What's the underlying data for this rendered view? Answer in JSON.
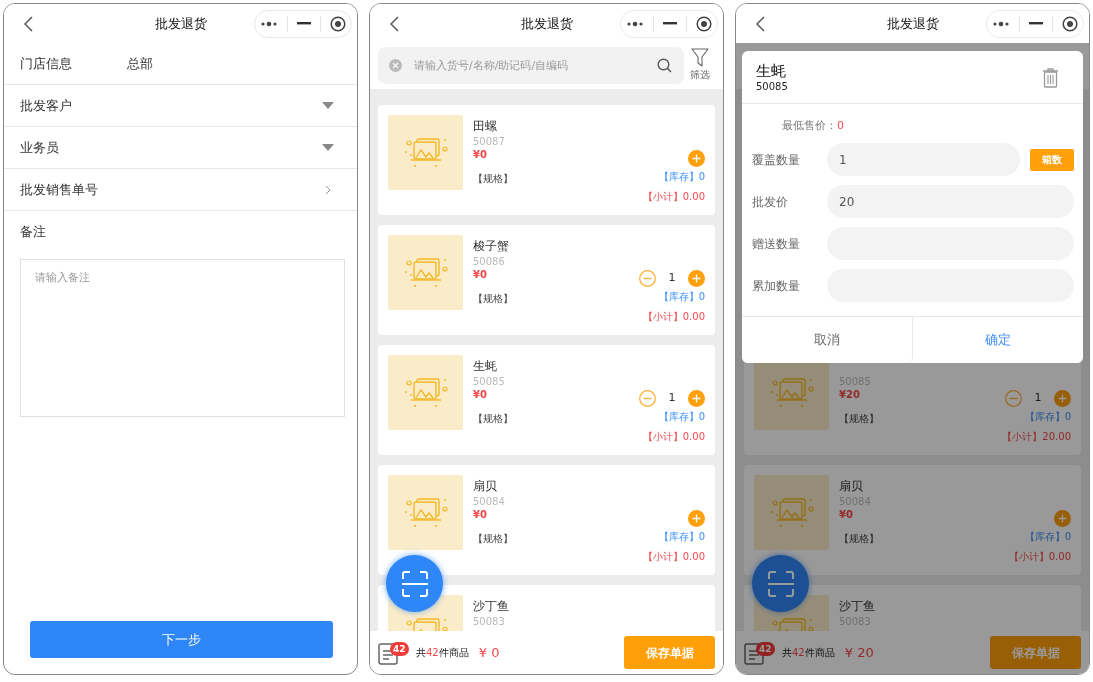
{
  "form_screen": {
    "title": "批发退货",
    "rows": [
      {
        "kind": "info",
        "label": "门店信息",
        "value": "总部"
      },
      {
        "kind": "dropdown",
        "label": "批发客户"
      },
      {
        "kind": "dropdown",
        "label": "业务员"
      },
      {
        "kind": "link",
        "label": "批发销售单号"
      },
      {
        "kind": "notes",
        "label": "备注",
        "placeholder": "请输入备注"
      }
    ],
    "next_button": "下一步"
  },
  "list_screen": {
    "title": "批发退货",
    "search": {
      "placeholder": "请输入货号/名称/助记码/自编码"
    },
    "filter_label": "筛选",
    "products": [
      {
        "name": "田螺",
        "code": "50087",
        "price": "¥0",
        "spec": "【规格】",
        "stock": "【库存】0",
        "subtotal": "【小计】0.00"
      },
      {
        "name": "梭子蟹",
        "code": "50086",
        "price": "¥0",
        "quantity": "1",
        "spec": "【规格】",
        "stock": "【库存】0",
        "subtotal": "【小计】0.00"
      },
      {
        "name": "生蚝",
        "code": "50085",
        "price": "¥0",
        "quantity": "1",
        "spec": "【规格】",
        "stock": "【库存】0",
        "subtotal": "【小计】0.00"
      },
      {
        "name": "扇贝",
        "code": "50084",
        "price": "¥0",
        "spec": "【规格】",
        "stock": "【库存】0",
        "subtotal": "【小计】0.00"
      },
      {
        "name": "沙丁鱼",
        "code": "50083"
      }
    ],
    "footer": {
      "badge": "42",
      "count_prefix": "共",
      "count": "42",
      "count_suffix": "件商品",
      "total": "¥ 0",
      "save_button": "保存单据"
    }
  },
  "dialog_screen": {
    "title": "批发退货",
    "products": [
      {
        "code": "50085",
        "price": "¥20",
        "quantity": "1",
        "spec": "【规格】",
        "stock": "【库存】0",
        "subtotal": "【小计】20.00"
      },
      {
        "name": "扇贝",
        "code": "50084",
        "price": "¥0",
        "spec": "【规格】",
        "stock": "【库存】0",
        "subtotal": "【小计】0.00"
      },
      {
        "name": "沙丁鱼",
        "code": "50083"
      }
    ],
    "footer": {
      "badge": "42",
      "count_prefix": "共",
      "count": "42",
      "count_suffix": "件商品",
      "total": "¥ 20",
      "save_button": "保存单据"
    },
    "dialog": {
      "name": "生蚝",
      "code": "50085",
      "min_price_label": "最低售价：",
      "min_price": "0",
      "fields": [
        {
          "label": "覆盖数量",
          "value": "1",
          "button": "箱数"
        },
        {
          "label": "批发价",
          "value": "20"
        },
        {
          "label": "赠送数量"
        },
        {
          "label": "累加数量"
        }
      ],
      "cancel": "取消",
      "confirm": "确定"
    }
  }
}
